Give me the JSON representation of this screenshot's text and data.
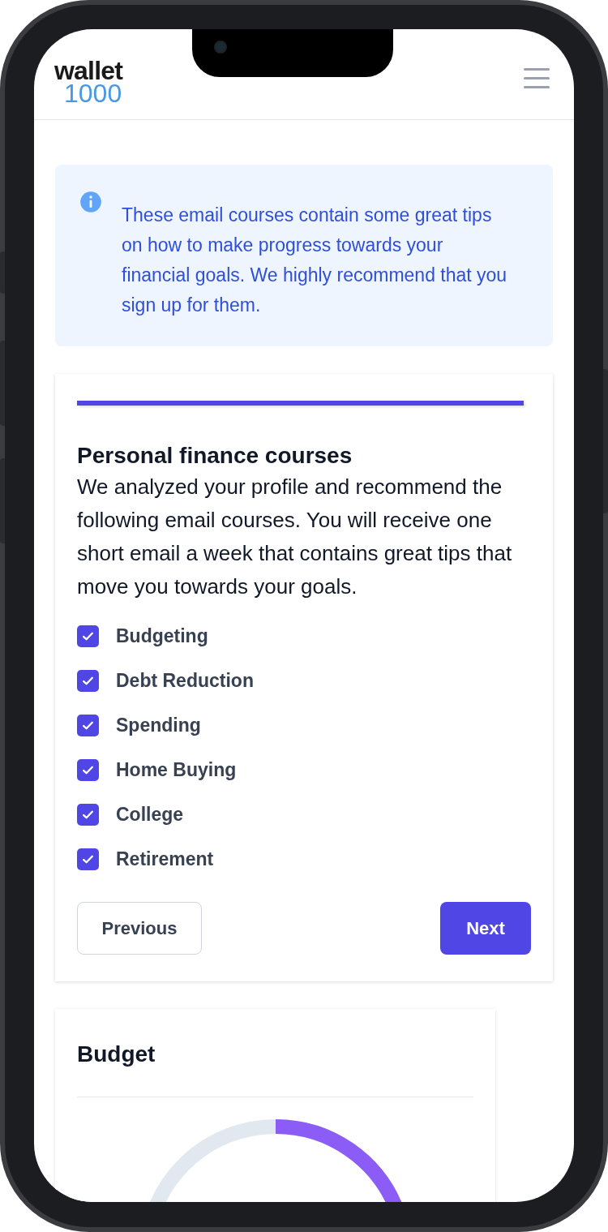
{
  "header": {
    "logo": {
      "line1": "wallet",
      "line2": "1000"
    }
  },
  "info": {
    "text": "These email courses contain some great tips on how to make progress towards your financial goals. We highly recommend that you sign up for them."
  },
  "courses_card": {
    "progress": {
      "level": 1
    },
    "title": "Personal finance courses",
    "description": "We analyzed your profile and recommend the following email courses. You will receive one short email a week that contains great tips that move you towards your goals.",
    "options": [
      {
        "label": "Budgeting",
        "checked": true
      },
      {
        "label": "Debt Reduction",
        "checked": true
      },
      {
        "label": "Spending",
        "checked": true
      },
      {
        "label": "Home Buying",
        "checked": true
      },
      {
        "label": "College",
        "checked": true
      },
      {
        "label": "Retirement",
        "checked": true
      }
    ],
    "buttons": {
      "previous": "Previous",
      "next": "Next"
    }
  },
  "budget_card": {
    "title": "Budget"
  }
}
